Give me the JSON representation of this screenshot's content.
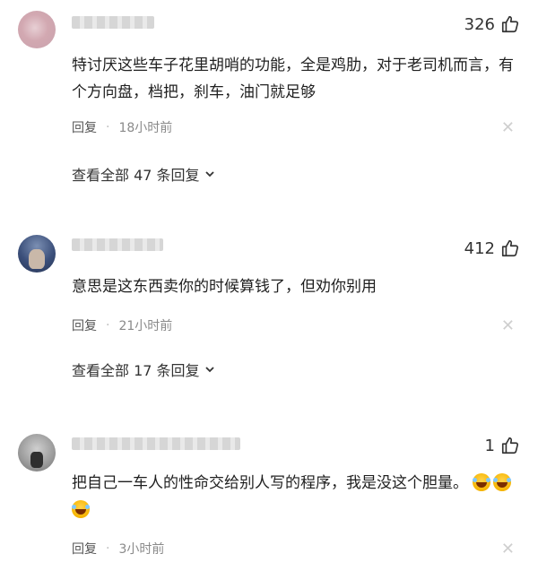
{
  "comments": [
    {
      "likes": "326",
      "text": "特讨厌这些车子花里胡哨的功能，全是鸡肋，对于老司机而言，有个方向盘，档把，刹车，油门就足够",
      "reply_label": "回复",
      "time": "18小时前",
      "more_replies": "查看全部 47 条回复"
    },
    {
      "likes": "412",
      "text": "意思是这东西卖你的时候算钱了，但劝你别用",
      "reply_label": "回复",
      "time": "21小时前",
      "more_replies": "查看全部 17 条回复"
    },
    {
      "likes": "1",
      "text": "把自己一车人的性命交给别人写的程序，我是没这个胆量。",
      "emoji": [
        "laughing-crying-emoji",
        "laughing-crying-emoji",
        "laughing-crying-emoji"
      ],
      "reply_label": "回复",
      "time": "3小时前"
    }
  ],
  "icons": {
    "like": "thumb-up-icon",
    "close": "close-icon",
    "chevron": "chevron-down-icon"
  }
}
